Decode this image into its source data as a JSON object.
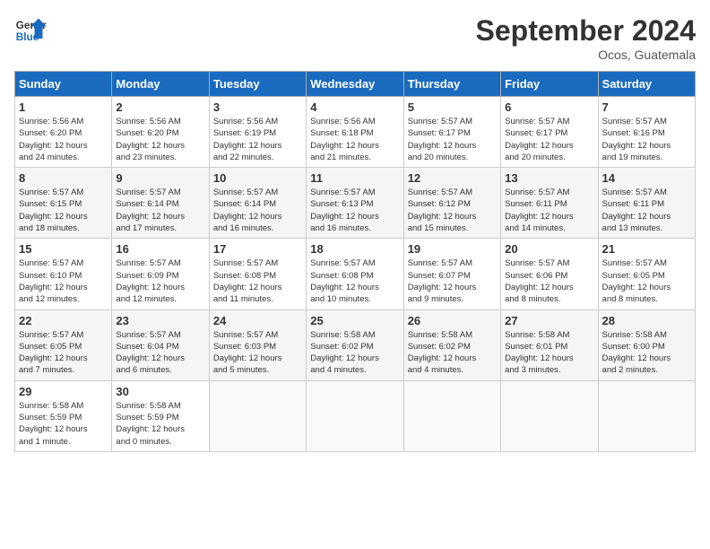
{
  "header": {
    "logo_line1": "General",
    "logo_line2": "Blue",
    "month": "September 2024",
    "location": "Ocos, Guatemala"
  },
  "days_of_week": [
    "Sunday",
    "Monday",
    "Tuesday",
    "Wednesday",
    "Thursday",
    "Friday",
    "Saturday"
  ],
  "weeks": [
    [
      {
        "day": "1",
        "info": "Sunrise: 5:56 AM\nSunset: 6:20 PM\nDaylight: 12 hours\nand 24 minutes."
      },
      {
        "day": "2",
        "info": "Sunrise: 5:56 AM\nSunset: 6:20 PM\nDaylight: 12 hours\nand 23 minutes."
      },
      {
        "day": "3",
        "info": "Sunrise: 5:56 AM\nSunset: 6:19 PM\nDaylight: 12 hours\nand 22 minutes."
      },
      {
        "day": "4",
        "info": "Sunrise: 5:56 AM\nSunset: 6:18 PM\nDaylight: 12 hours\nand 21 minutes."
      },
      {
        "day": "5",
        "info": "Sunrise: 5:57 AM\nSunset: 6:17 PM\nDaylight: 12 hours\nand 20 minutes."
      },
      {
        "day": "6",
        "info": "Sunrise: 5:57 AM\nSunset: 6:17 PM\nDaylight: 12 hours\nand 20 minutes."
      },
      {
        "day": "7",
        "info": "Sunrise: 5:57 AM\nSunset: 6:16 PM\nDaylight: 12 hours\nand 19 minutes."
      }
    ],
    [
      {
        "day": "8",
        "info": "Sunrise: 5:57 AM\nSunset: 6:15 PM\nDaylight: 12 hours\nand 18 minutes."
      },
      {
        "day": "9",
        "info": "Sunrise: 5:57 AM\nSunset: 6:14 PM\nDaylight: 12 hours\nand 17 minutes."
      },
      {
        "day": "10",
        "info": "Sunrise: 5:57 AM\nSunset: 6:14 PM\nDaylight: 12 hours\nand 16 minutes."
      },
      {
        "day": "11",
        "info": "Sunrise: 5:57 AM\nSunset: 6:13 PM\nDaylight: 12 hours\nand 16 minutes."
      },
      {
        "day": "12",
        "info": "Sunrise: 5:57 AM\nSunset: 6:12 PM\nDaylight: 12 hours\nand 15 minutes."
      },
      {
        "day": "13",
        "info": "Sunrise: 5:57 AM\nSunset: 6:11 PM\nDaylight: 12 hours\nand 14 minutes."
      },
      {
        "day": "14",
        "info": "Sunrise: 5:57 AM\nSunset: 6:11 PM\nDaylight: 12 hours\nand 13 minutes."
      }
    ],
    [
      {
        "day": "15",
        "info": "Sunrise: 5:57 AM\nSunset: 6:10 PM\nDaylight: 12 hours\nand 12 minutes."
      },
      {
        "day": "16",
        "info": "Sunrise: 5:57 AM\nSunset: 6:09 PM\nDaylight: 12 hours\nand 12 minutes."
      },
      {
        "day": "17",
        "info": "Sunrise: 5:57 AM\nSunset: 6:08 PM\nDaylight: 12 hours\nand 11 minutes."
      },
      {
        "day": "18",
        "info": "Sunrise: 5:57 AM\nSunset: 6:08 PM\nDaylight: 12 hours\nand 10 minutes."
      },
      {
        "day": "19",
        "info": "Sunrise: 5:57 AM\nSunset: 6:07 PM\nDaylight: 12 hours\nand 9 minutes."
      },
      {
        "day": "20",
        "info": "Sunrise: 5:57 AM\nSunset: 6:06 PM\nDaylight: 12 hours\nand 8 minutes."
      },
      {
        "day": "21",
        "info": "Sunrise: 5:57 AM\nSunset: 6:05 PM\nDaylight: 12 hours\nand 8 minutes."
      }
    ],
    [
      {
        "day": "22",
        "info": "Sunrise: 5:57 AM\nSunset: 6:05 PM\nDaylight: 12 hours\nand 7 minutes."
      },
      {
        "day": "23",
        "info": "Sunrise: 5:57 AM\nSunset: 6:04 PM\nDaylight: 12 hours\nand 6 minutes."
      },
      {
        "day": "24",
        "info": "Sunrise: 5:57 AM\nSunset: 6:03 PM\nDaylight: 12 hours\nand 5 minutes."
      },
      {
        "day": "25",
        "info": "Sunrise: 5:58 AM\nSunset: 6:02 PM\nDaylight: 12 hours\nand 4 minutes."
      },
      {
        "day": "26",
        "info": "Sunrise: 5:58 AM\nSunset: 6:02 PM\nDaylight: 12 hours\nand 4 minutes."
      },
      {
        "day": "27",
        "info": "Sunrise: 5:58 AM\nSunset: 6:01 PM\nDaylight: 12 hours\nand 3 minutes."
      },
      {
        "day": "28",
        "info": "Sunrise: 5:58 AM\nSunset: 6:00 PM\nDaylight: 12 hours\nand 2 minutes."
      }
    ],
    [
      {
        "day": "29",
        "info": "Sunrise: 5:58 AM\nSunset: 5:59 PM\nDaylight: 12 hours\nand 1 minute."
      },
      {
        "day": "30",
        "info": "Sunrise: 5:58 AM\nSunset: 5:59 PM\nDaylight: 12 hours\nand 0 minutes."
      },
      {
        "day": "",
        "info": ""
      },
      {
        "day": "",
        "info": ""
      },
      {
        "day": "",
        "info": ""
      },
      {
        "day": "",
        "info": ""
      },
      {
        "day": "",
        "info": ""
      }
    ]
  ]
}
